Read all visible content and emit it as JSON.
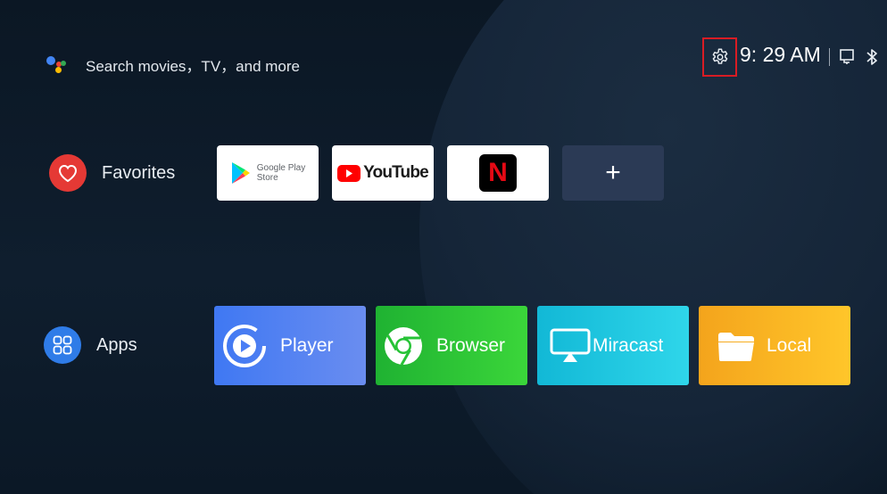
{
  "header": {
    "search_placeholder": "Search movies，TV，and more",
    "time": "9: 29 AM"
  },
  "rows": {
    "favorites": {
      "label": "Favorites",
      "tiles": [
        {
          "name": "Google Play Store",
          "line1": "Google Play",
          "line2": "Store"
        },
        {
          "name": "YouTube",
          "text": "YouTube"
        },
        {
          "name": "Netflix",
          "text": "N"
        },
        {
          "name": "Add",
          "text": "+"
        }
      ]
    },
    "apps": {
      "label": "Apps",
      "tiles": [
        {
          "label": "Player",
          "icon": "player-icon",
          "color": "#4a7ef5"
        },
        {
          "label": "Browser",
          "icon": "chrome-icon",
          "color": "#27c336"
        },
        {
          "label": "Miracast",
          "icon": "miracast-icon",
          "color": "#1cc5df"
        },
        {
          "label": "Local",
          "icon": "folder-icon",
          "color": "#f9b521"
        }
      ]
    }
  },
  "colors": {
    "background": "#0d1b2a",
    "highlight_box": "#d81c24",
    "favorites_icon": "#e53935",
    "apps_icon": "#2f7ce8"
  }
}
